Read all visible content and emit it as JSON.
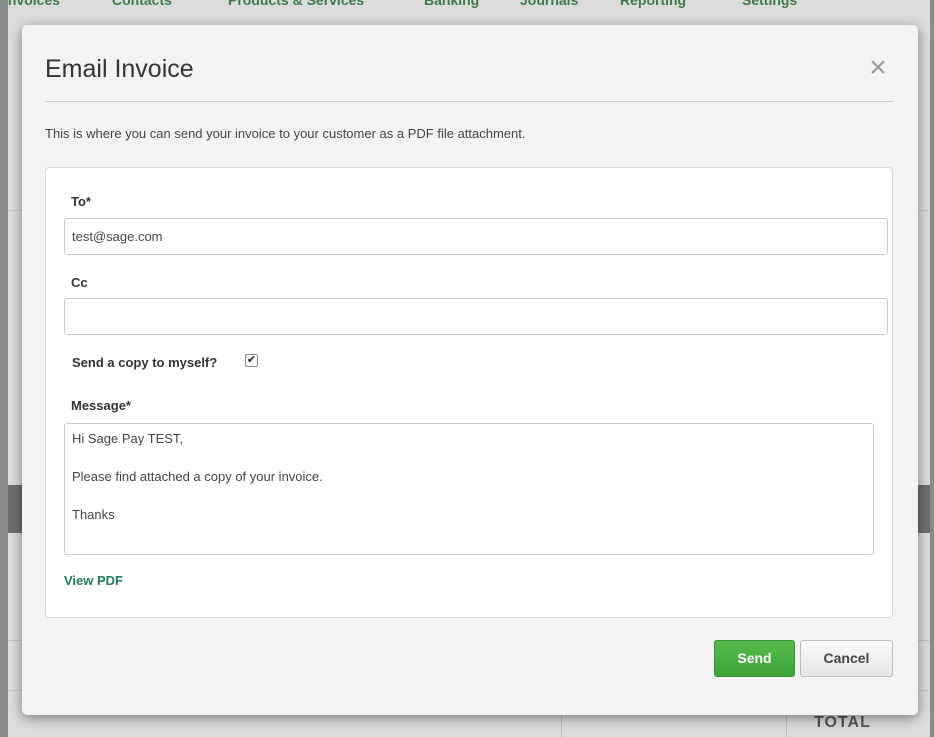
{
  "background": {
    "nav": [
      "Invoices",
      "Contacts",
      "Products & Services",
      "Banking",
      "Journals",
      "Reporting",
      "Settings"
    ],
    "total_label": "TOTAL"
  },
  "modal": {
    "title": "Email Invoice",
    "close_icon": "×",
    "intro": "This is where you can send your invoice to your customer as a PDF file attachment.",
    "to_label": "To*",
    "to_value": "test@sage.com",
    "cc_label": "Cc",
    "cc_value": "",
    "copy_label": "Send a copy to myself?",
    "copy_checked": true,
    "message_label": "Message*",
    "message_lines": [
      "Hi Sage Pay TEST,",
      "Please find attached a copy of your invoice.",
      "Thanks"
    ],
    "view_pdf": "View PDF",
    "send_label": "Send",
    "cancel_label": "Cancel"
  },
  "colors": {
    "send_button": "#4cb044",
    "link": "#1e7c5a"
  }
}
